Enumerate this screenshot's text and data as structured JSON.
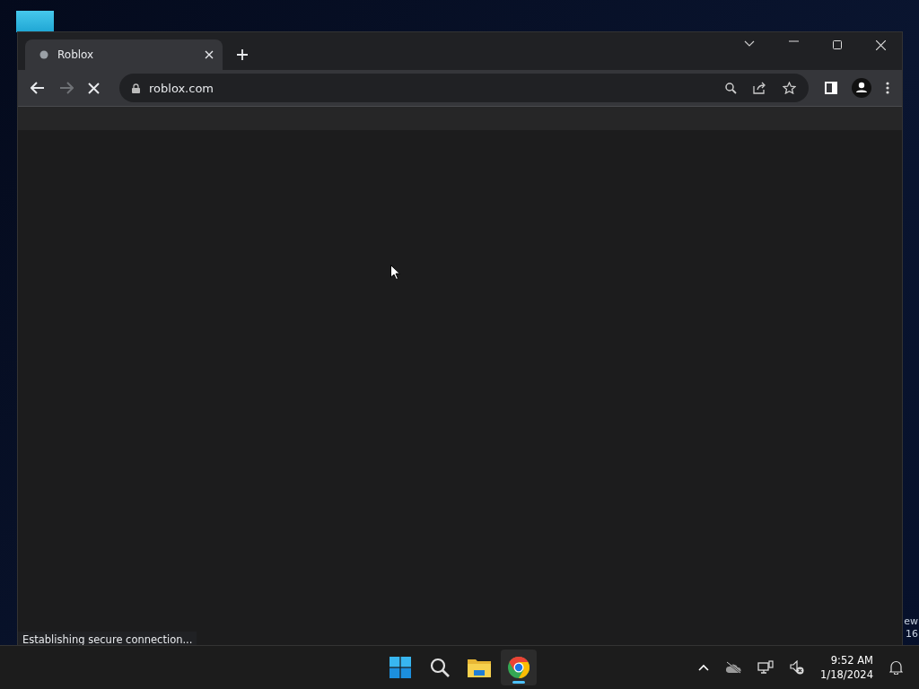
{
  "browser": {
    "tabs": [
      {
        "title": "Roblox",
        "selected": true
      }
    ],
    "address": "roblox.com",
    "loading": true,
    "status_text": "Establishing secure connection..."
  },
  "desktop": {
    "edge_texts": [
      "ew",
      "16"
    ]
  },
  "taskbar": {
    "apps": [
      {
        "kind": "start",
        "selected": false
      },
      {
        "kind": "search",
        "selected": false
      },
      {
        "kind": "files",
        "selected": false
      },
      {
        "kind": "chrome",
        "selected": true
      }
    ],
    "clock": {
      "time": "9:52 AM",
      "date": "1/18/2024"
    }
  }
}
